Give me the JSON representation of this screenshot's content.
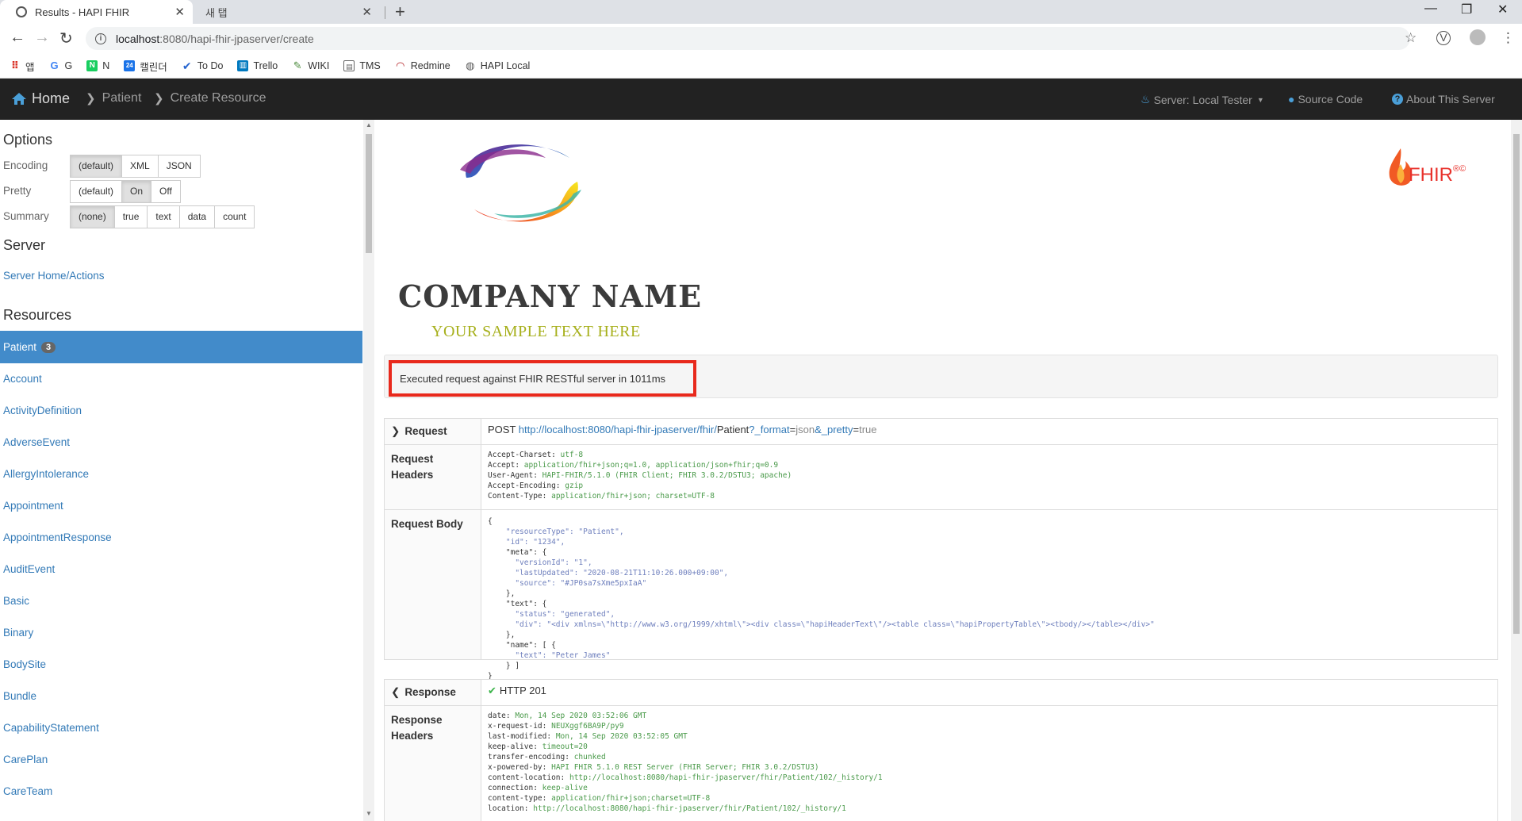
{
  "browser": {
    "active_tab_title": "Results - HAPI FHIR",
    "inactive_tab_title": "새 탭",
    "url_host": "localhost",
    "url_rest": ":8080/hapi-fhir-jpaserver/create",
    "bookmarks": [
      {
        "label": "앱",
        "icon": "apps-grid-icon",
        "color": "#4285f4"
      },
      {
        "label": "G",
        "icon": "google-icon",
        "color": "#4285f4"
      },
      {
        "label": "N",
        "icon": "naver-icon",
        "color": "#19ce60"
      },
      {
        "label": "캘린더",
        "icon": "calendar-icon",
        "color": "#1a73e8"
      },
      {
        "label": "To Do",
        "icon": "todo-check-icon",
        "color": "#2564cf"
      },
      {
        "label": "Trello",
        "icon": "trello-icon",
        "color": "#0079bf"
      },
      {
        "label": "WIKI",
        "icon": "wiki-icon",
        "color": "#4a8a3c"
      },
      {
        "label": "TMS",
        "icon": "chart-icon",
        "color": "#666666"
      },
      {
        "label": "Redmine",
        "icon": "redmine-icon",
        "color": "#b32024"
      },
      {
        "label": "HAPI Local",
        "icon": "globe-icon",
        "color": "#555555"
      }
    ]
  },
  "navbar": {
    "home": "Home",
    "crumb1": "Patient",
    "crumb2": "Create Resource",
    "server": "Server: Local Tester",
    "source_code": "Source Code",
    "about": "About This Server"
  },
  "sidebar": {
    "options_heading": "Options",
    "encoding_label": "Encoding",
    "encoding_options": [
      "(default)",
      "XML",
      "JSON"
    ],
    "pretty_label": "Pretty",
    "pretty_options": [
      "(default)",
      "On",
      "Off"
    ],
    "summary_label": "Summary",
    "summary_options": [
      "(none)",
      "true",
      "text",
      "data",
      "count"
    ],
    "server_heading": "Server",
    "server_link": "Server Home/Actions",
    "resources_heading": "Resources",
    "active_resource": "Patient",
    "active_resource_count": "3",
    "resources": [
      "Account",
      "ActivityDefinition",
      "AdverseEvent",
      "AllergyIntolerance",
      "Appointment",
      "AppointmentResponse",
      "AuditEvent",
      "Basic",
      "Binary",
      "BodySite",
      "Bundle",
      "CapabilityStatement",
      "CarePlan",
      "CareTeam"
    ]
  },
  "main": {
    "company_name": "COMPANY NAME",
    "company_tagline": "YOUR SAMPLE TEXT HERE",
    "fhir_logo_text": "FHIR",
    "fhir_logo_mark": "®©",
    "exec_message": "Executed request against FHIR RESTful server in 1011ms",
    "request_label": "Request",
    "request_method": "POST",
    "request_url": "http://localhost:8080/hapi-fhir-jpaserver/fhir/",
    "request_resource": "Patient",
    "request_q1_key": "?_format",
    "request_q1_val": "json",
    "request_q2_key": "&_pretty",
    "request_q2_val": "true",
    "request_headers_label": "Request Headers",
    "request_headers": [
      {
        "k": "Accept-Charset",
        "v": "utf-8"
      },
      {
        "k": "Accept",
        "v": "application/fhir+json;q=1.0, application/json+fhir;q=0.9"
      },
      {
        "k": "User-Agent",
        "v": "HAPI-FHIR/5.1.0 (FHIR Client; FHIR 3.0.2/DSTU3; apache)"
      },
      {
        "k": "Accept-Encoding",
        "v": "gzip"
      },
      {
        "k": "Content-Type",
        "v": "application/fhir+json; charset=UTF-8"
      }
    ],
    "request_body_label": "Request Body",
    "request_body_lines": [
      "{",
      "    \"resourceType\": \"Patient\",",
      "    \"id\": \"1234\",",
      "    \"meta\": {",
      "      \"versionId\": \"1\",",
      "      \"lastUpdated\": \"2020-08-21T11:10:26.000+09:00\",",
      "      \"source\": \"#JP0sa7sXme5pxIaA\"",
      "    },",
      "    \"text\": {",
      "      \"status\": \"generated\",",
      "      \"div\": \"<div xmlns=\\\"http://www.w3.org/1999/xhtml\\\"><div class=\\\"hapiHeaderText\\\"/><table class=\\\"hapiPropertyTable\\\"><tbody/></table></div>\"",
      "    },",
      "    \"name\": [ {",
      "      \"text\": \"Peter James\"",
      "    } ]",
      "}"
    ],
    "response_label": "Response",
    "response_status": "HTTP 201",
    "response_headers_label": "Response Headers",
    "response_headers": [
      {
        "k": "date",
        "v": "Mon, 14 Sep 2020 03:52:06 GMT"
      },
      {
        "k": "x-request-id",
        "v": "NEUXggf6BA9P/py9"
      },
      {
        "k": "last-modified",
        "v": "Mon, 14 Sep 2020 03:52:05 GMT"
      },
      {
        "k": "keep-alive",
        "v": "timeout=20"
      },
      {
        "k": "transfer-encoding",
        "v": "chunked"
      },
      {
        "k": "x-powered-by",
        "v": "HAPI FHIR 5.1.0 REST Server (FHIR Server; FHIR 3.0.2/DSTU3)"
      },
      {
        "k": "content-location",
        "v": "http://localhost:8080/hapi-fhir-jpaserver/fhir/Patient/102/_history/1"
      },
      {
        "k": "connection",
        "v": "keep-alive"
      },
      {
        "k": "content-type",
        "v": "application/fhir+json;charset=UTF-8"
      },
      {
        "k": "location",
        "v": "http://localhost:8080/hapi-fhir-jpaserver/fhir/Patient/102/_history/1"
      }
    ]
  },
  "colors": {
    "navbar_bg": "#222222",
    "active_resource_bg": "#428bca",
    "highlight_border": "#e8291c",
    "link": "#337ab7",
    "header_value": "#4a9a4a"
  }
}
